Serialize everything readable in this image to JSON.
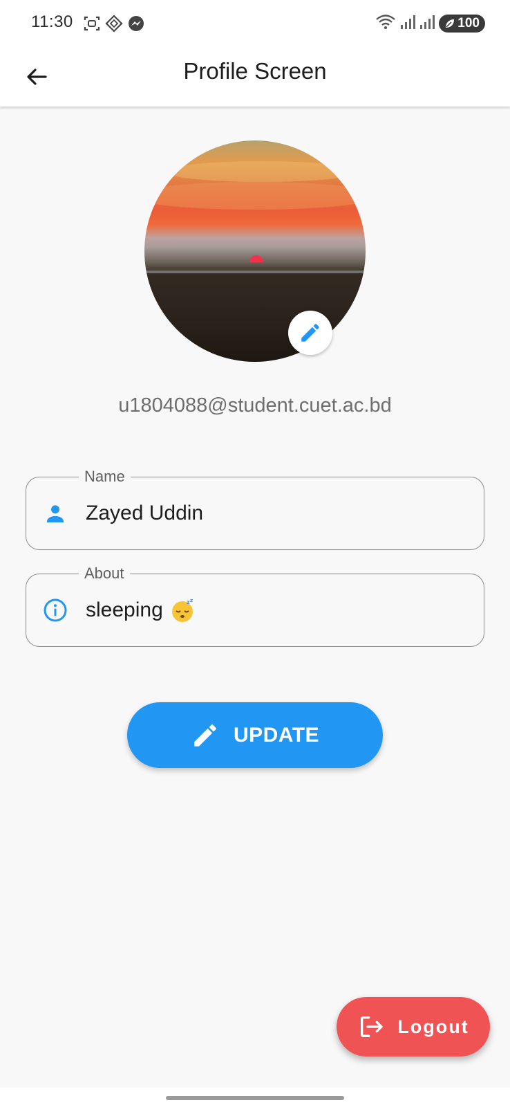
{
  "status_bar": {
    "time": "11:30",
    "battery": "100",
    "left_icons": [
      "screenshot-icon",
      "dnd-diamond-icon",
      "messenger-icon"
    ],
    "right_icons": [
      "wifi-icon",
      "signal-icon",
      "signal-icon",
      "battery-icon"
    ]
  },
  "app_bar": {
    "title": "Profile Screen",
    "back_icon": "arrow-back-icon"
  },
  "profile": {
    "avatar_icon": "sunset-photo",
    "edit_icon": "pencil-icon",
    "email": "u1804088@student.cuet.ac.bd"
  },
  "form": {
    "name": {
      "label": "Name",
      "value": "Zayed Uddin",
      "icon": "person-icon"
    },
    "about": {
      "label": "About",
      "value": "sleeping",
      "emoji": "sleeping-face-emoji",
      "icon": "info-icon"
    }
  },
  "actions": {
    "update_label": "UPDATE",
    "update_icon": "pencil-icon",
    "logout_label": "Logout",
    "logout_icon": "logout-icon"
  },
  "colors": {
    "primary": "#2196f3",
    "logout": "#f05354",
    "background": "#f8f8f8",
    "text_secondary": "#6d6d6d"
  }
}
